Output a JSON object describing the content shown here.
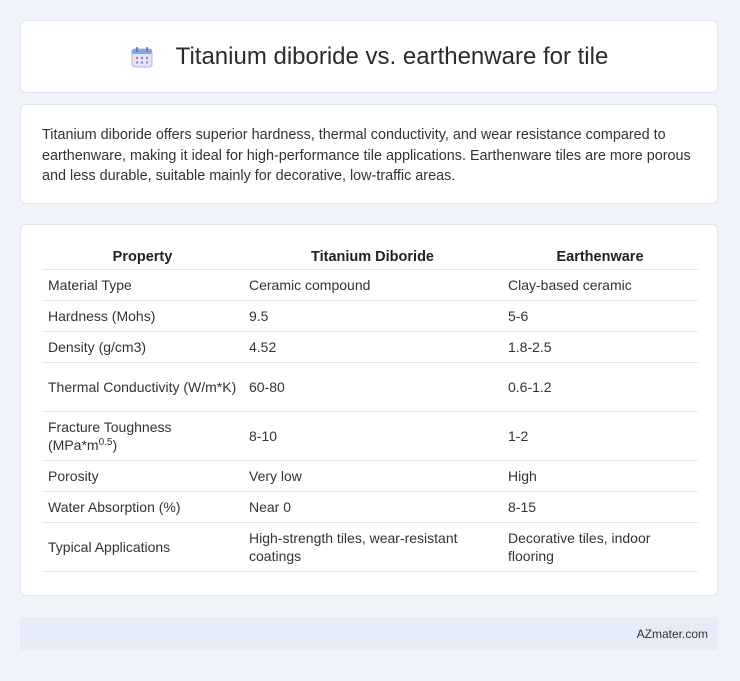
{
  "header": {
    "title": "Titanium diboride vs. earthenware for tile",
    "icon": "calendar-icon"
  },
  "intro": {
    "text": "Titanium diboride offers superior hardness, thermal conductivity, and wear resistance compared to earthenware, making it ideal for high-performance tile applications. Earthenware tiles are more porous and less durable, suitable mainly for decorative, low-traffic areas."
  },
  "table": {
    "headers": [
      "Property",
      "Titanium Diboride",
      "Earthenware"
    ],
    "rows": [
      [
        "Material Type",
        "Ceramic compound",
        "Clay-based ceramic"
      ],
      [
        "Hardness (Mohs)",
        "9.5",
        "5-6"
      ],
      [
        "Density (g/cm3)",
        "4.52",
        "1.8-2.5"
      ],
      [
        "Thermal Conductivity (W/m*K)",
        "60-80",
        "0.6-1.2"
      ],
      [
        "Fracture Toughness (MPa*m",
        "0.5",
        ")",
        "8-10",
        "1-2"
      ],
      [
        "Porosity",
        "Very low",
        "High"
      ],
      [
        "Water Absorption (%)",
        "Near 0",
        "8-15"
      ],
      [
        "Typical Applications",
        "High-strength tiles, wear-resistant coatings",
        "Decorative tiles, indoor flooring"
      ]
    ]
  },
  "footer": {
    "text": "AZmater.com"
  }
}
